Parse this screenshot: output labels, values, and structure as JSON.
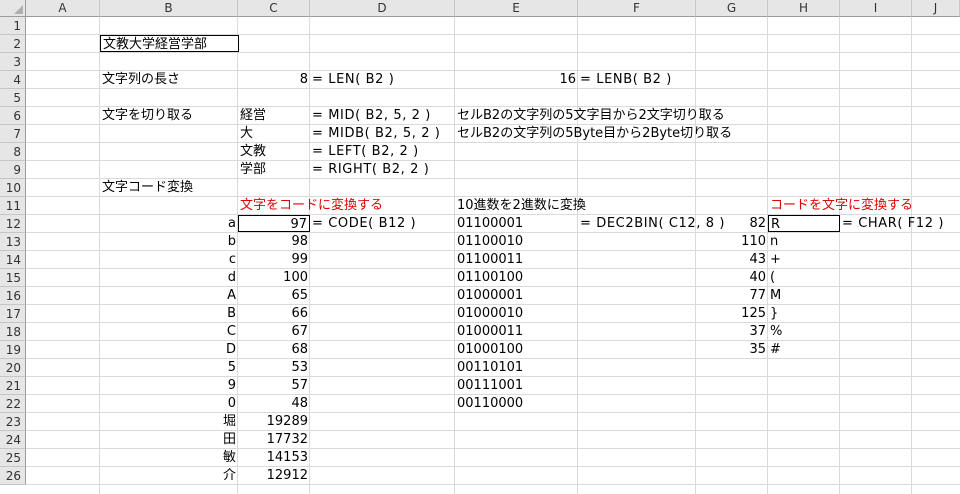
{
  "columns": [
    "A",
    "B",
    "C",
    "D",
    "E",
    "F",
    "G",
    "H",
    "I",
    "J"
  ],
  "rows": [
    "1",
    "2",
    "3",
    "4",
    "5",
    "6",
    "7",
    "8",
    "9",
    "10",
    "11",
    "12",
    "13",
    "14",
    "15",
    "16",
    "17",
    "18",
    "19",
    "20",
    "21",
    "22",
    "23",
    "24",
    "25",
    "26"
  ],
  "b2": "文教大学経営学部",
  "r4": {
    "label": "文字列の長さ",
    "len": "8",
    "len_formula": "= LEN( B2 )",
    "lenb": "16",
    "lenb_formula": "= LENB( B2 )"
  },
  "r6": {
    "label": "文字を切り取る",
    "value": "経営",
    "formula": "= MID( B2, 5, 2 )",
    "note": "セルB2の文字列の5文字目から2文字切り取る"
  },
  "r7": {
    "value": "大",
    "formula": "= MIDB( B2, 5, 2 )",
    "note": "セルB2の文字列の5Byte目から2Byte切り取る"
  },
  "r8": {
    "value": "文教",
    "formula": "= LEFT( B2, 2 )"
  },
  "r9": {
    "value": "学部",
    "formula": "= RIGHT( B2, 2 )"
  },
  "r10": {
    "label": "文字コード変換"
  },
  "r11": {
    "code_title": "文字をコードに変換する",
    "bin_title": "10進数を2進数に変換",
    "char_title": "コードを文字に変換する"
  },
  "code_formula": "= CODE( B12 )",
  "bin_formula": "= DEC2BIN( C12, 8 )",
  "char_formula": "= CHAR( F12 )",
  "code_table": [
    {
      "ch": "a",
      "code": "97"
    },
    {
      "ch": "b",
      "code": "98"
    },
    {
      "ch": "c",
      "code": "99"
    },
    {
      "ch": "d",
      "code": "100"
    },
    {
      "ch": "A",
      "code": "65"
    },
    {
      "ch": "B",
      "code": "66"
    },
    {
      "ch": "C",
      "code": "67"
    },
    {
      "ch": "D",
      "code": "68"
    },
    {
      "ch": "5",
      "code": "53"
    },
    {
      "ch": "9",
      "code": "57"
    },
    {
      "ch": "0",
      "code": "48"
    },
    {
      "ch": "堀",
      "code": "19289"
    },
    {
      "ch": "田",
      "code": "17732"
    },
    {
      "ch": "敏",
      "code": "14153"
    },
    {
      "ch": "介",
      "code": "12912"
    }
  ],
  "bin_table": [
    "01100001",
    "01100010",
    "01100011",
    "01100100",
    "01000001",
    "01000010",
    "01000011",
    "01000100",
    "00110101",
    "00111001",
    "00110000"
  ],
  "char_table": [
    {
      "code": "82",
      "ch": "R"
    },
    {
      "code": "110",
      "ch": "n"
    },
    {
      "code": "43",
      "ch": "+"
    },
    {
      "code": "40",
      "ch": "("
    },
    {
      "code": "77",
      "ch": "M"
    },
    {
      "code": "125",
      "ch": "}"
    },
    {
      "code": "37",
      "ch": "%"
    },
    {
      "code": "35",
      "ch": "#"
    }
  ]
}
